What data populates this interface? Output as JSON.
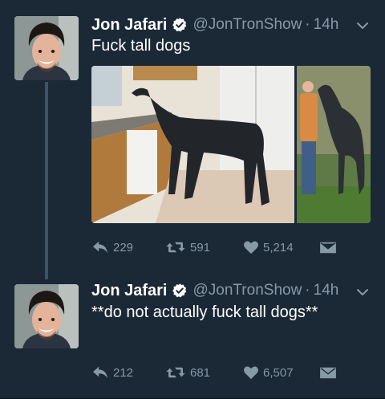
{
  "colors": {
    "background": "#1b2836",
    "secondary_text": "#8899a6",
    "verified_badge": "#ffffff",
    "thread_line": "#3d5466"
  },
  "tweets": [
    {
      "display_name": "Jon Jafari",
      "handle": "@JonTronShow",
      "separator": "·",
      "time": "14h",
      "text": "Fuck tall dogs",
      "icon_avatar": "avatar-photo",
      "reply_count": "229",
      "retweet_count": "591",
      "like_count": "5,214"
    },
    {
      "display_name": "Jon Jafari",
      "handle": "@JonTronShow",
      "separator": "·",
      "time": "14h",
      "text": "**do not actually fuck tall dogs**",
      "icon_avatar": "avatar-photo",
      "reply_count": "212",
      "retweet_count": "681",
      "like_count": "6,507"
    }
  ]
}
